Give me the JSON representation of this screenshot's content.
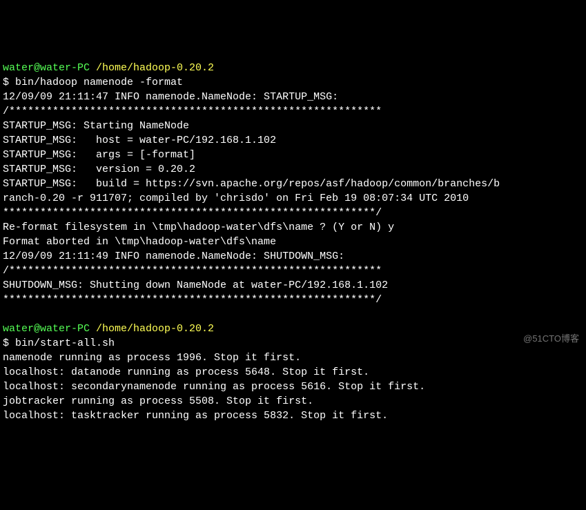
{
  "prompt1": {
    "user_host": "water@water-PC",
    "path": "/home/hadoop-0.20.2",
    "dollar": "$",
    "command": "bin/hadoop namenode -format"
  },
  "output1": [
    "12/09/09 21:11:47 INFO namenode.NameNode: STARTUP_MSG:",
    "/************************************************************",
    "STARTUP_MSG: Starting NameNode",
    "STARTUP_MSG:   host = water-PC/192.168.1.102",
    "STARTUP_MSG:   args = [-format]",
    "STARTUP_MSG:   version = 0.20.2",
    "STARTUP_MSG:   build = https://svn.apache.org/repos/asf/hadoop/common/branches/b",
    "ranch-0.20 -r 911707; compiled by 'chrisdo' on Fri Feb 19 08:07:34 UTC 2010",
    "************************************************************/",
    "Re-format filesystem in \\tmp\\hadoop-water\\dfs\\name ? (Y or N) y",
    "Format aborted in \\tmp\\hadoop-water\\dfs\\name",
    "12/09/09 21:11:49 INFO namenode.NameNode: SHUTDOWN_MSG:",
    "/************************************************************",
    "SHUTDOWN_MSG: Shutting down NameNode at water-PC/192.168.1.102",
    "************************************************************/",
    ""
  ],
  "prompt2": {
    "user_host": "water@water-PC",
    "path": "/home/hadoop-0.20.2",
    "dollar": "$",
    "command": "bin/start-all.sh"
  },
  "output2": [
    "namenode running as process 1996. Stop it first.",
    "localhost: datanode running as process 5648. Stop it first.",
    "localhost: secondarynamenode running as process 5616. Stop it first.",
    "jobtracker running as process 5508. Stop it first.",
    "localhost: tasktracker running as process 5832. Stop it first."
  ],
  "watermark": "@51CTO博客"
}
